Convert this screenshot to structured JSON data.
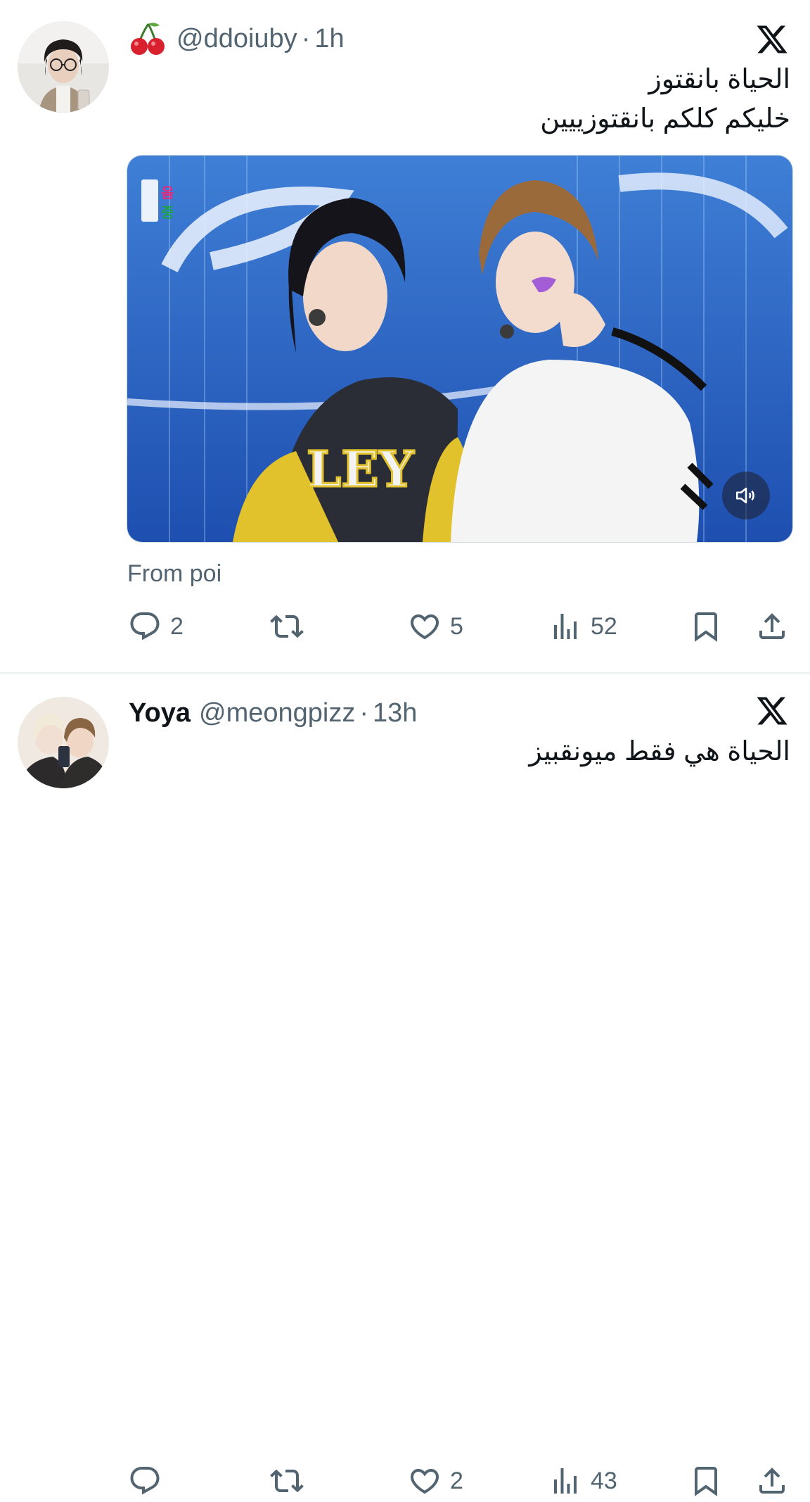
{
  "tweets": [
    {
      "display_name": "",
      "handle": "@ddoiuby",
      "time": "1h",
      "separator": "·",
      "text_lines": [
        "الحياة بانقتوز",
        "خليكم كلكم بانقتوزييين"
      ],
      "media": {
        "type": "video",
        "broadcaster_logo": "음중"
      },
      "caption": "From poi",
      "stats": {
        "replies": "2",
        "retweets": "",
        "likes": "5",
        "views": "52"
      }
    },
    {
      "display_name": "Yoya",
      "handle": "@meongpizz",
      "time": "13h",
      "separator": "·",
      "text_lines": [
        "الحياة هي فقط ميونقبيز"
      ],
      "stats": {
        "replies": "",
        "retweets": "",
        "likes": "2",
        "views": "43"
      }
    }
  ],
  "icons": [
    "cherry-emoji-icon",
    "x-logo-icon",
    "reply-icon",
    "retweet-icon",
    "like-icon",
    "views-icon",
    "bookmark-icon",
    "share-icon",
    "sound-icon"
  ],
  "colors": {
    "text_primary": "#0f1419",
    "text_secondary": "#536471",
    "divider": "#eff3f4"
  }
}
